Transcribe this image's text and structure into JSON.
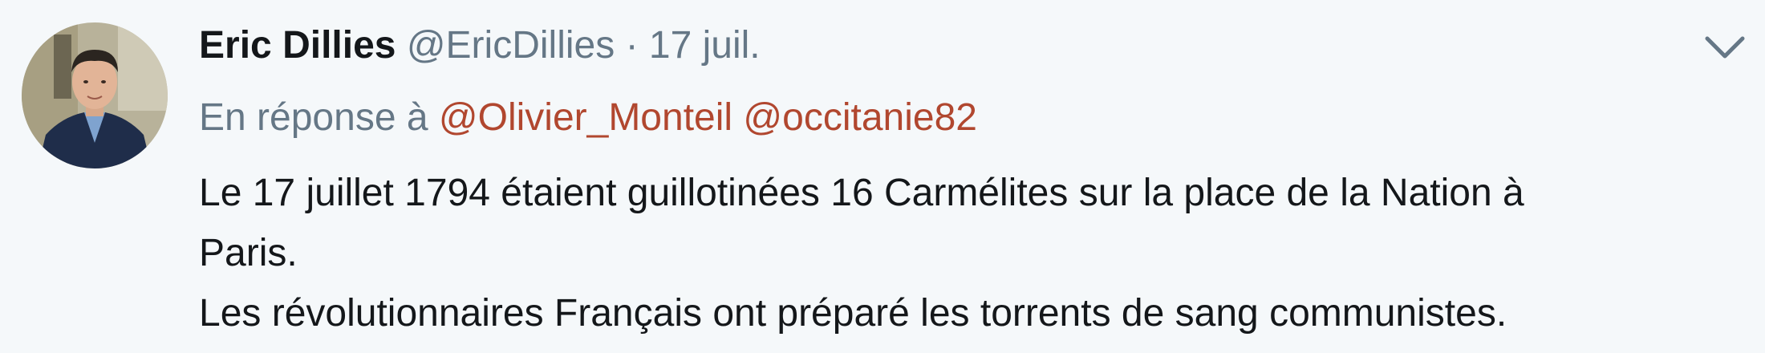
{
  "tweet": {
    "author": {
      "name": "Eric Dillies",
      "handle": "@EricDillies"
    },
    "separator": "·",
    "timestamp": "17 juil.",
    "reply_context": {
      "prefix": "En réponse à",
      "mentions": [
        "@Olivier_Monteil",
        "@occitanie82"
      ]
    },
    "text_lines": [
      "Le 17 juillet 1794 étaient guillotinées 16 Carmélites sur la place de la Nation à",
      "Paris.",
      "Les révolutionnaires Français ont préparé les torrents de sang communistes."
    ],
    "icons": {
      "menu": "chevron-down-icon",
      "avatar": "avatar"
    },
    "colors": {
      "background": "#f5f8fa",
      "text": "#14171a",
      "secondary": "#657786",
      "mention": "#b1472f"
    }
  }
}
